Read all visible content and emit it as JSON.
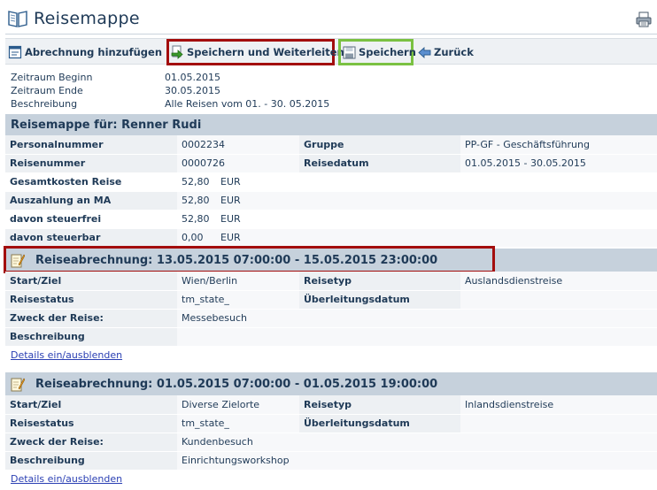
{
  "app": {
    "title": "Reisemappe"
  },
  "toolbar": {
    "add_label": "Abrechnung hinzufügen",
    "save_forward_label": "Speichern und Weiterleiten",
    "save_label": "Speichern",
    "back_label": "Zurück"
  },
  "meta": {
    "rows": [
      {
        "label": "Zeitraum Beginn",
        "value": "01.05.2015"
      },
      {
        "label": "Zeitraum Ende",
        "value": "30.05.2015"
      },
      {
        "label": "Beschreibung",
        "value": "Alle Reisen vom 01. - 30. 05.2015"
      }
    ]
  },
  "person": {
    "heading": "Reisemappe für: Renner Rudi",
    "personalnummer_label": "Personalnummer",
    "personalnummer": "0002234",
    "gruppe_label": "Gruppe",
    "gruppe": "PP-GF - Geschäftsführung",
    "reisenummer_label": "Reisenummer",
    "reisenummer": "0000726",
    "reisedatum_label": "Reisedatum",
    "reisedatum": "01.05.2015 - 30.05.2015",
    "amounts": [
      {
        "label": "Gesamtkosten Reise",
        "value": "52,80",
        "currency": "EUR"
      },
      {
        "label": "Auszahlung an MA",
        "value": "52,80",
        "currency": "EUR"
      },
      {
        "label": "davon steuerfrei",
        "value": "52,80",
        "currency": "EUR"
      },
      {
        "label": "davon steuerbar",
        "value": "0,00",
        "currency": "EUR"
      }
    ]
  },
  "trips": [
    {
      "heading": "Reiseabrechnung: 13.05.2015 07:00:00 - 15.05.2015 23:00:00",
      "start_ziel_label": "Start/Ziel",
      "start_ziel": "Wien/Berlin",
      "reisetyp_label": "Reisetyp",
      "reisetyp": "Auslandsdienstreise",
      "reisestatus_label": "Reisestatus",
      "reisestatus": "tm_state_",
      "ueberleitung_label": "Überleitungsdatum",
      "ueberleitung": "",
      "zweck_label": "Zweck der Reise:",
      "zweck": "Messebesuch",
      "beschreibung_label": "Beschreibung",
      "beschreibung": "",
      "details_link": "Details ein/ausblenden"
    },
    {
      "heading": "Reiseabrechnung: 01.05.2015 07:00:00 - 01.05.2015 19:00:00",
      "start_ziel_label": "Start/Ziel",
      "start_ziel": "Diverse Zielorte",
      "reisetyp_label": "Reisetyp",
      "reisetyp": "Inlandsdienstreise",
      "reisestatus_label": "Reisestatus",
      "reisestatus": "tm_state_",
      "ueberleitung_label": "Überleitungsdatum",
      "ueberleitung": "",
      "zweck_label": "Zweck der Reise:",
      "zweck": "Kundenbesuch",
      "beschreibung_label": "Beschreibung",
      "beschreibung": "Einrichtungsworkshop",
      "details_link": "Details ein/ausblenden"
    }
  ],
  "icons": {
    "title": "open-book-icon",
    "print": "printer-icon",
    "add": "form-add-icon",
    "save_forward": "save-forward-icon",
    "save": "floppy-disk-icon",
    "back": "back-arrow-icon",
    "trip": "pencil-note-icon"
  },
  "colors": {
    "header_band": "#c6d1dc",
    "label_cell": "#edf0f3",
    "highlight_red": "#a30d0d",
    "highlight_green": "#7ac142",
    "link": "#2a3fb3"
  }
}
